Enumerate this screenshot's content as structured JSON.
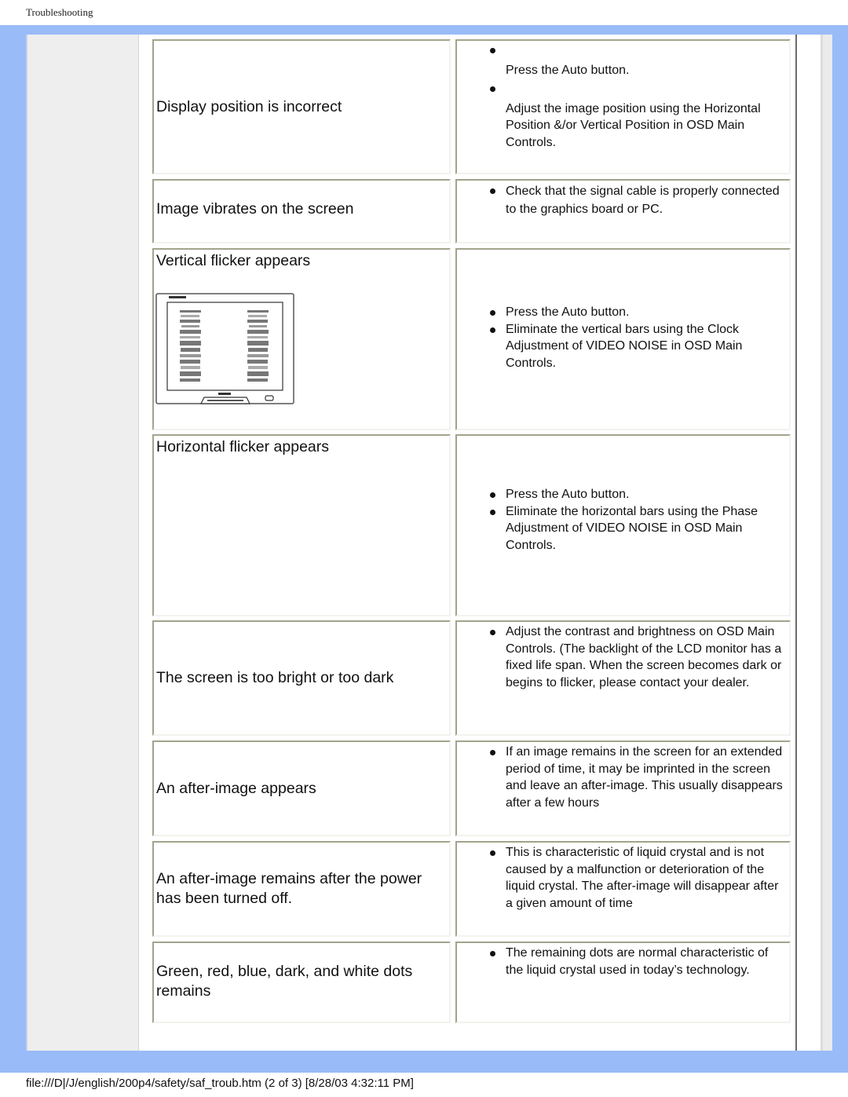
{
  "header": {
    "title": "Troubleshooting"
  },
  "rows": [
    {
      "problem": "Display position is incorrect",
      "solutions": [
        "Press the Auto button.",
        "Adjust the image position using the Horizontal Position &/or Vertical Position in OSD Main Controls."
      ]
    },
    {
      "problem": "Image vibrates on the screen",
      "solutions": [
        "Check that the signal cable is properly connected to the graphics board or PC."
      ]
    },
    {
      "problem": "Vertical flicker appears",
      "image": "vertical-flicker-monitor-illustration",
      "solutions": [
        "Press the Auto button.",
        "Eliminate the vertical bars using the Clock Adjustment of VIDEO NOISE in OSD Main Controls."
      ]
    },
    {
      "problem": "Horizontal flicker appears",
      "solutions": [
        "Press the Auto button.",
        "Eliminate the horizontal bars using the Phase Adjustment of VIDEO NOISE in OSD Main Controls."
      ]
    },
    {
      "problem": "The screen is too bright or too dark",
      "solutions": [
        "Adjust the contrast and brightness on OSD Main Controls. (The backlight of the LCD monitor has a fixed life span. When the screen becomes dark or begins to flicker, please contact your dealer."
      ]
    },
    {
      "problem": "An after-image appears",
      "solutions": [
        "If an image remains in the screen for an extended period of time, it may be imprinted in the screen and leave an after-image. This usually disappears after a few hours"
      ]
    },
    {
      "problem": "An after-image remains after the power has been turned off.",
      "solutions": [
        "This is characteristic of liquid crystal and is not caused by a malfunction or deterioration of the liquid crystal. The after-image will disappear after a given amount of time"
      ]
    },
    {
      "problem": "Green, red, blue, dark, and white dots remains",
      "solutions": [
        "The remaining dots are normal characteristic of the liquid crystal used in today’s technology."
      ]
    }
  ],
  "footer": {
    "text": "file:///D|/J/english/200p4/safety/saf_troub.htm (2 of 3) [8/28/03 4:32:11 PM]"
  },
  "colors": {
    "frame_blue": "#99bbf7",
    "side_panel_gray": "#eeeeee",
    "cell_border": "#a3a38c"
  }
}
